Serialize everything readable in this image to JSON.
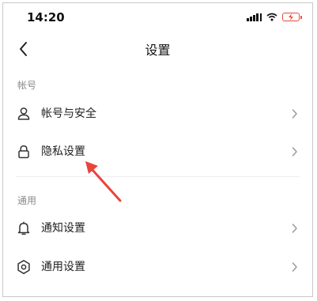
{
  "status_bar": {
    "time": "14:20"
  },
  "nav": {
    "title": "设置"
  },
  "sections": [
    {
      "label": "帐号",
      "items": [
        {
          "label": "帐号与安全",
          "icon": "user-icon"
        },
        {
          "label": "隐私设置",
          "icon": "lock-icon"
        }
      ]
    },
    {
      "label": "通用",
      "items": [
        {
          "label": "通知设置",
          "icon": "bell-icon"
        },
        {
          "label": "通用设置",
          "icon": "gear-icon"
        }
      ]
    }
  ],
  "colors": {
    "annotation_arrow": "#e8453c",
    "battery": "#e84b3a"
  }
}
